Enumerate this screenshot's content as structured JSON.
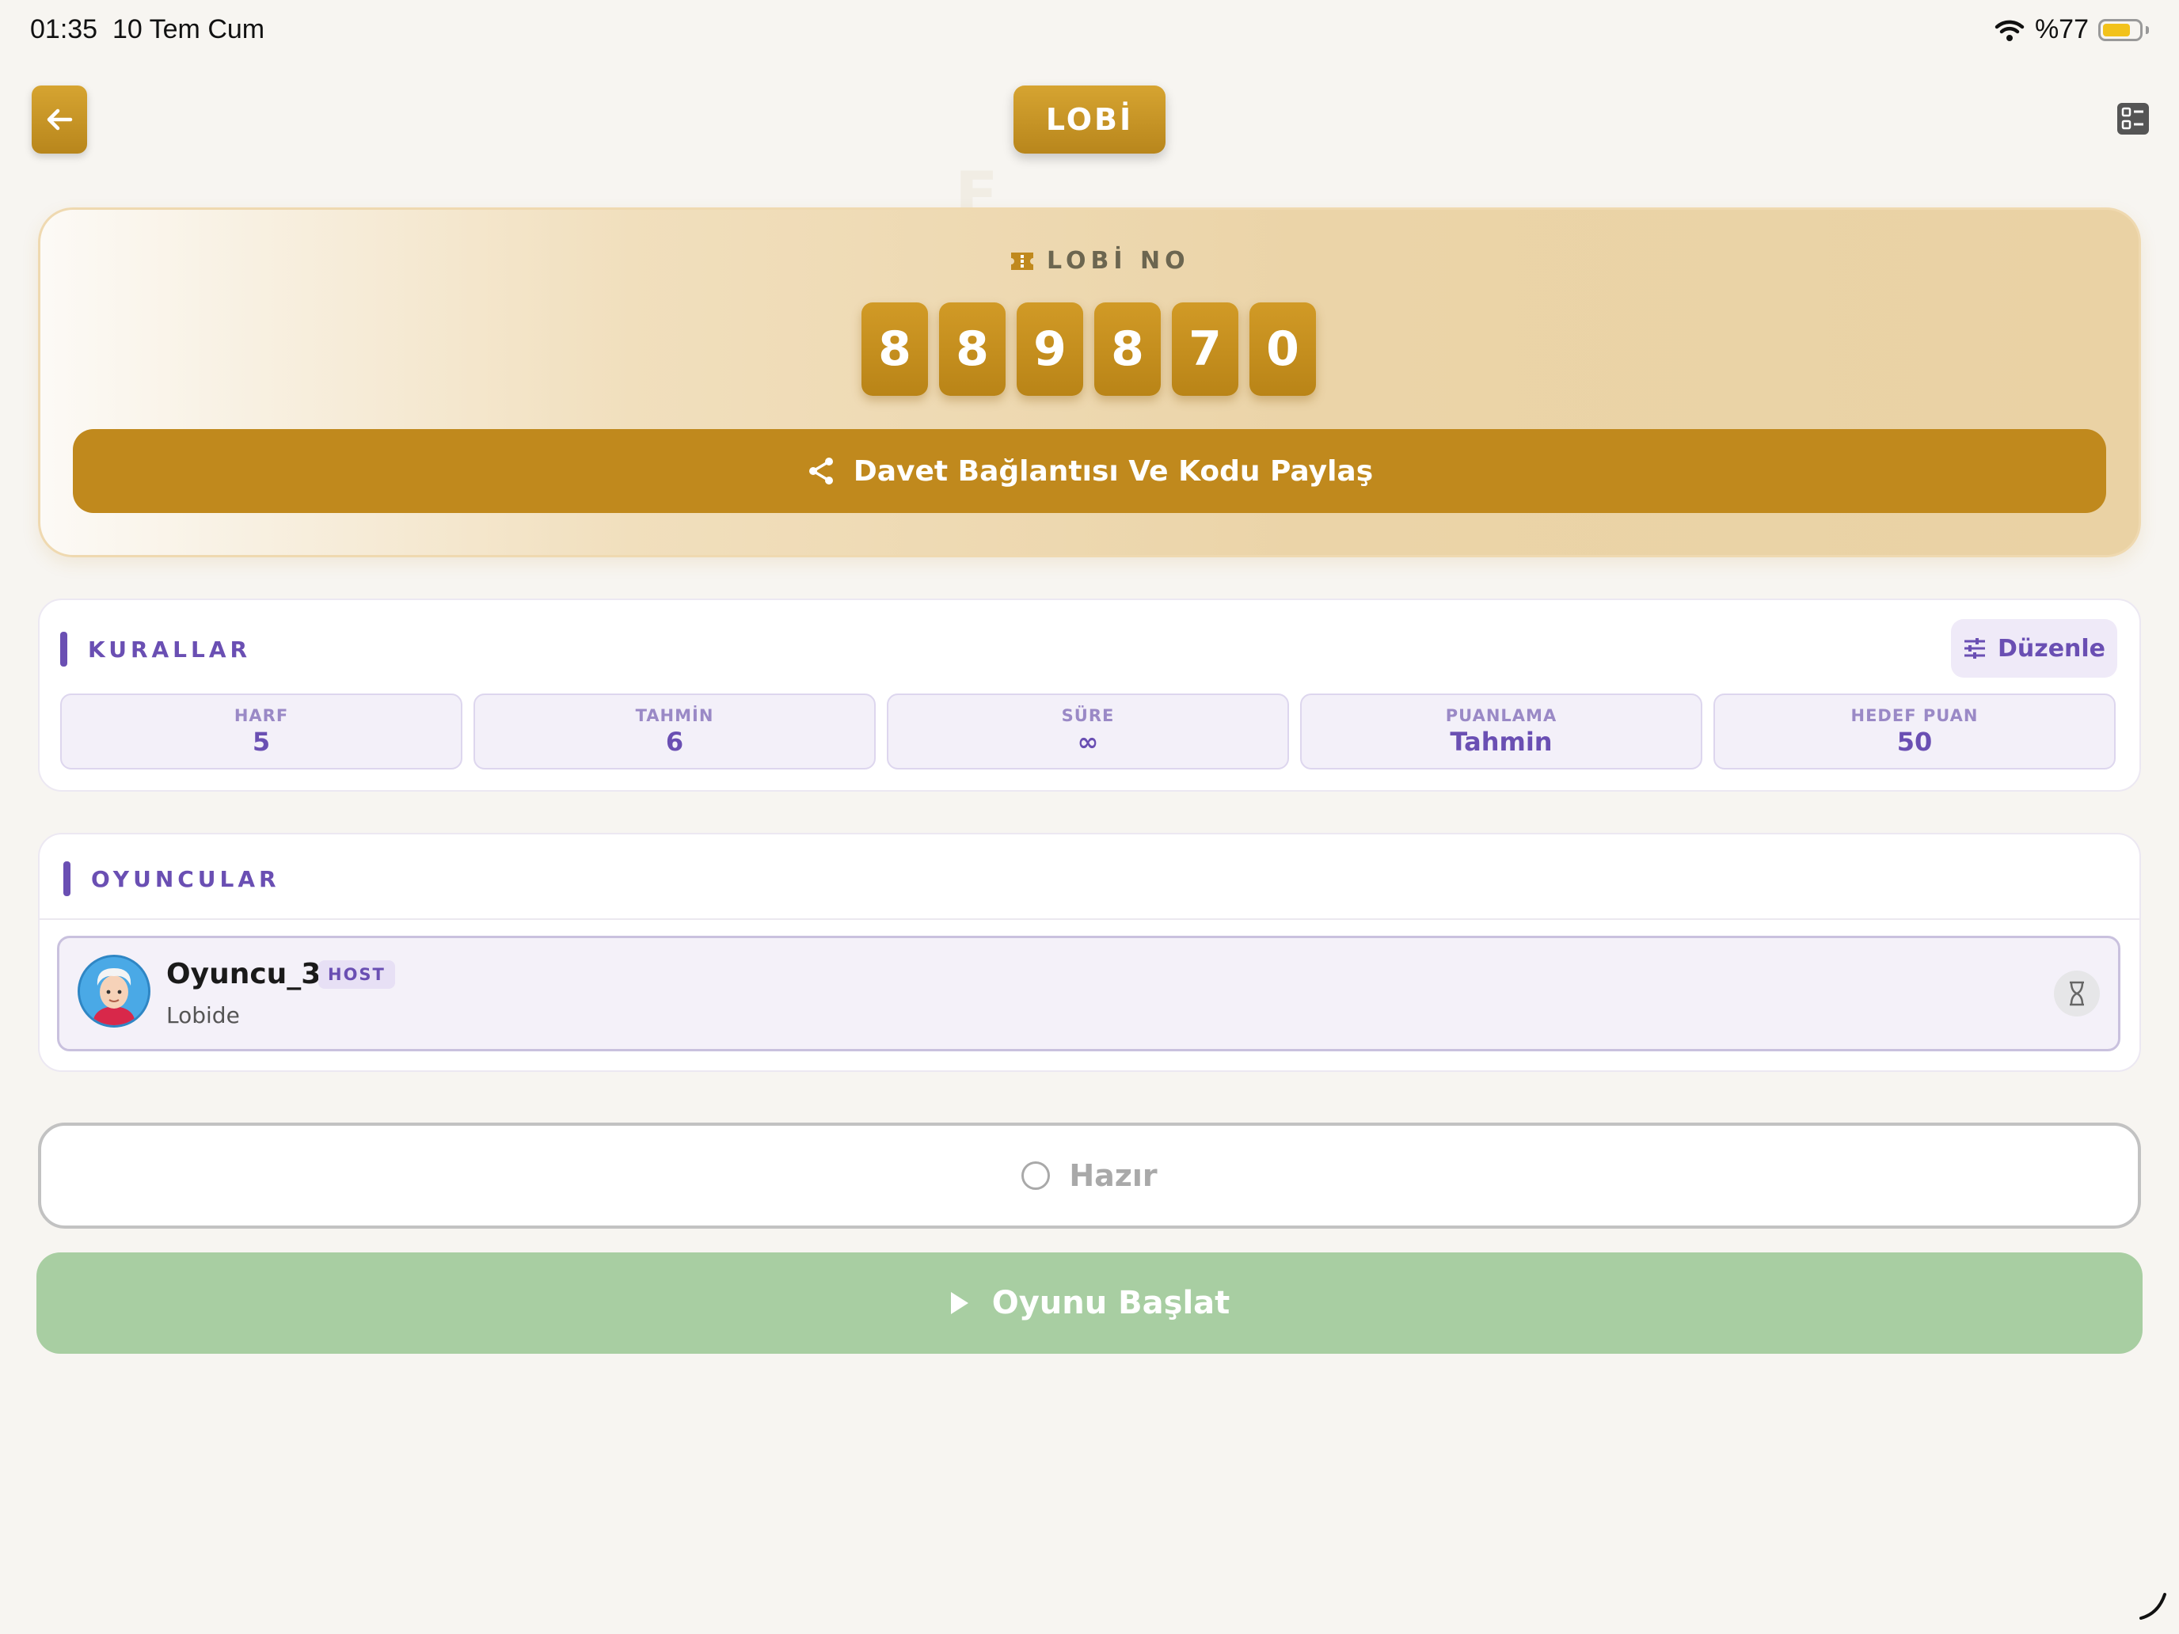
{
  "status_bar": {
    "time": "01:35",
    "date": "10 Tem Cum",
    "battery": "%77",
    "battery_level": 0.77
  },
  "header": {
    "title": "LOBİ"
  },
  "lobby": {
    "label": "LOBİ NO",
    "digits": [
      "8",
      "8",
      "9",
      "8",
      "7",
      "0"
    ],
    "share_label": "Davet Bağlantısı Ve Kodu Paylaş"
  },
  "rules": {
    "title": "KURALLAR",
    "edit_label": "Düzenle",
    "items": [
      {
        "label": "HARF",
        "value": "5"
      },
      {
        "label": "TAHMİN",
        "value": "6"
      },
      {
        "label": "SÜRE",
        "value": "∞"
      },
      {
        "label": "PUANLAMA",
        "value": "Tahmin"
      },
      {
        "label": "HEDEF PUAN",
        "value": "50"
      }
    ]
  },
  "players": {
    "title": "OYUNCULAR",
    "list": [
      {
        "name": "Oyuncu_3",
        "badge": "HOST",
        "status": "Lobide"
      }
    ]
  },
  "actions": {
    "ready_label": "Hazır",
    "start_label": "Oyunu Başlat"
  },
  "colors": {
    "gold": "#c0891d",
    "purple": "#6a4fb3",
    "green": "#a8cea2"
  }
}
